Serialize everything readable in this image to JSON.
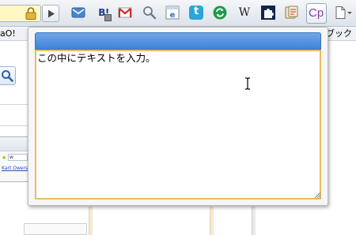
{
  "toolbar": {
    "icons": [
      "lock-icon",
      "play-icon",
      "mail-icon",
      "hatena-bookmark-icon",
      "gmail-icon",
      "search-icon",
      "ie-tab-icon",
      "twitter-icon",
      "refresh-icon",
      "wikipedia-icon",
      "puzzle-icon",
      "copy-icon",
      "page-menu-icon"
    ],
    "hatena_label": "B!",
    "wikipedia_label": "W",
    "twitter_label": "t",
    "copy_button_label": "Cp",
    "accent": "#4a8ad9"
  },
  "bookmarks": {
    "left_text": "aO!",
    "right_text": "ブック"
  },
  "page": {
    "mini_url": "w",
    "mini_links": "Kart  Owerse"
  },
  "popup": {
    "textarea_value": "この中にテキストを入力。",
    "header_color": "#4a8ad9",
    "border_color": "#e7be63"
  }
}
